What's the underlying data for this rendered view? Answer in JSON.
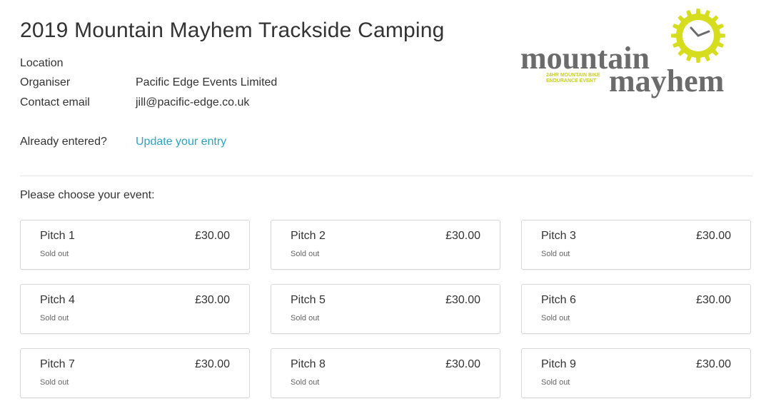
{
  "header": {
    "title": "2019 Mountain Mayhem Trackside Camping"
  },
  "info": {
    "location_label": "Location",
    "organiser_label": "Organiser",
    "organiser_value": "Pacific Edge Events Limited",
    "contact_label": "Contact email",
    "contact_value": "jill@pacific-edge.co.uk",
    "already_label": "Already entered?",
    "update_link": "Update your entry"
  },
  "logo": {
    "word1": "mountain",
    "word2": "mayhem",
    "tagline1": "24HR MOUNTAIN BIKE",
    "tagline2": "ENDURANCE EVENT",
    "icon": "clock-gear-icon",
    "accent_color": "#d6dd1f",
    "text_color": "#6b6b6b"
  },
  "events": {
    "prompt": "Please choose your event:",
    "items": [
      {
        "name": "Pitch 1",
        "price": "£30.00",
        "status": "Sold out"
      },
      {
        "name": "Pitch 2",
        "price": "£30.00",
        "status": "Sold out"
      },
      {
        "name": "Pitch 3",
        "price": "£30.00",
        "status": "Sold out"
      },
      {
        "name": "Pitch 4",
        "price": "£30.00",
        "status": "Sold out"
      },
      {
        "name": "Pitch 5",
        "price": "£30.00",
        "status": "Sold out"
      },
      {
        "name": "Pitch 6",
        "price": "£30.00",
        "status": "Sold out"
      },
      {
        "name": "Pitch 7",
        "price": "£30.00",
        "status": "Sold out"
      },
      {
        "name": "Pitch 8",
        "price": "£30.00",
        "status": "Sold out"
      },
      {
        "name": "Pitch 9",
        "price": "£30.00",
        "status": "Sold out"
      }
    ]
  },
  "colors": {
    "link": "#2ea3c0",
    "text": "#333333",
    "border": "#d7d7d7"
  }
}
